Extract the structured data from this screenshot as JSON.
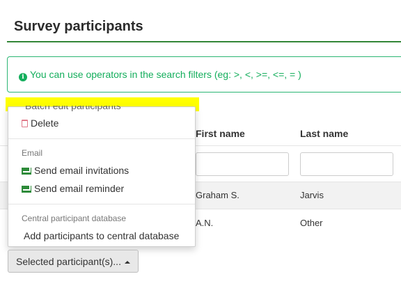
{
  "page": {
    "title": "Survey participants"
  },
  "info": {
    "text": "You can use operators in the search filters (eg: >, <, >=, <=, = )"
  },
  "table": {
    "columns": {
      "first_name": "First name",
      "last_name": "Last name"
    },
    "rows": [
      {
        "first_name": "Graham S.",
        "last_name": "Jarvis"
      },
      {
        "first_name": "A.N.",
        "last_name": "Other"
      }
    ]
  },
  "menu": {
    "batch_edit": "Batch edit participants",
    "delete": "Delete",
    "email_header": "Email",
    "send_invitations": "Send email invitations",
    "send_reminder": "Send email reminder",
    "cpdb_header": "Central participant database",
    "add_to_cpdb": "Add participants to central database"
  },
  "button": {
    "selected_label": "Selected participant(s)..."
  },
  "colors": {
    "accent": "#328637",
    "info": "#14ae5c",
    "highlight": "#ffff00"
  }
}
